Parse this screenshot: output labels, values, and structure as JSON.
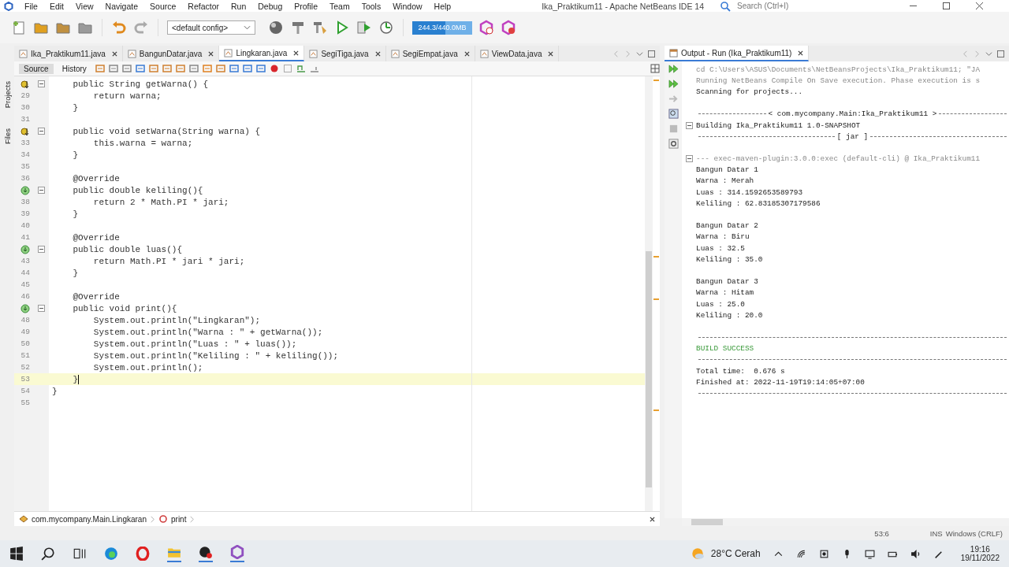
{
  "window": {
    "title": "Ika_Praktikum11 - Apache NetBeans IDE 14"
  },
  "menu": [
    "File",
    "Edit",
    "View",
    "Navigate",
    "Source",
    "Refactor",
    "Run",
    "Debug",
    "Profile",
    "Team",
    "Tools",
    "Window",
    "Help"
  ],
  "search": {
    "placeholder": "Search (Ctrl+I)"
  },
  "toolbar": {
    "config": "<default config>",
    "memory": {
      "reading": "244.3/440.0MB",
      "level": 0.55
    }
  },
  "side_tabs": [
    "Projects",
    "Files"
  ],
  "editor_tabs": [
    {
      "label": "Ika_Praktikum11.java",
      "selected": false
    },
    {
      "label": "BangunDatar.java",
      "selected": false
    },
    {
      "label": "Lingkaran.java",
      "selected": true
    },
    {
      "label": "SegiTiga.java",
      "selected": false
    },
    {
      "label": "SegiEmpat.java",
      "selected": false
    },
    {
      "label": "ViewData.java",
      "selected": false
    }
  ],
  "editor_views": [
    {
      "label": "Source",
      "selected": true
    },
    {
      "label": "History",
      "selected": false
    }
  ],
  "code_lines": [
    {
      "kind": "implements",
      "text": "    public String getWarna() {",
      "fold": true,
      "current": false
    },
    {
      "kind": "plain",
      "number": "29",
      "text": "        return warna;",
      "fold": false,
      "current": false
    },
    {
      "kind": "plain",
      "number": "30",
      "text": "    }",
      "fold": false,
      "current": false
    },
    {
      "kind": "plain",
      "number": "31",
      "fold": false,
      "current": false
    },
    {
      "kind": "implements",
      "text": "    public void setWarna(String warna) {",
      "fold": true,
      "current": false
    },
    {
      "kind": "plain",
      "number": "33",
      "text": "        this.warna = warna;",
      "fold": false,
      "current": false
    },
    {
      "kind": "plain",
      "number": "34",
      "text": "    }",
      "fold": false,
      "current": false
    },
    {
      "kind": "plain",
      "number": "35",
      "fold": false,
      "current": false
    },
    {
      "kind": "plain",
      "number": "36",
      "text": "    @Override",
      "fold": false,
      "current": false
    },
    {
      "kind": "overrides",
      "text": "    public double keliling(){",
      "fold": true,
      "current": false
    },
    {
      "kind": "plain",
      "number": "38",
      "text": "        return 2 * Math.PI * jari;",
      "fold": false,
      "current": false
    },
    {
      "kind": "plain",
      "number": "39",
      "text": "    }",
      "fold": false,
      "current": false
    },
    {
      "kind": "plain",
      "number": "40",
      "fold": false,
      "current": false
    },
    {
      "kind": "plain",
      "number": "41",
      "text": "    @Override",
      "fold": false,
      "current": false
    },
    {
      "kind": "overrides",
      "text": "    public double luas(){",
      "fold": true,
      "current": false
    },
    {
      "kind": "plain",
      "number": "43",
      "text": "        return Math.PI * jari * jari;",
      "fold": false,
      "current": false
    },
    {
      "kind": "plain",
      "number": "44",
      "text": "    }",
      "fold": false,
      "current": false
    },
    {
      "kind": "plain",
      "number": "45",
      "fold": false,
      "current": false
    },
    {
      "kind": "plain",
      "number": "46",
      "text": "    @Override",
      "fold": false,
      "current": false
    },
    {
      "kind": "overrides",
      "text": "    public void print(){",
      "fold": true,
      "current": false
    },
    {
      "kind": "plain",
      "number": "48",
      "text": "        System.out.println(\"Lingkaran\");",
      "fold": false,
      "current": false
    },
    {
      "kind": "plain",
      "number": "49",
      "text": "        System.out.println(\"Warna : \" + getWarna());",
      "fold": false,
      "current": false
    },
    {
      "kind": "plain",
      "number": "50",
      "text": "        System.out.println(\"Luas : \" + luas());",
      "fold": false,
      "current": false
    },
    {
      "kind": "plain",
      "number": "51",
      "text": "        System.out.println(\"Keliling : \" + keliling());",
      "fold": false,
      "current": false
    },
    {
      "kind": "plain",
      "number": "52",
      "text": "        System.out.println();",
      "fold": false,
      "current": false
    },
    {
      "kind": "plain",
      "number": "53",
      "text": "    }",
      "fold": false,
      "current": true
    },
    {
      "kind": "plain",
      "number": "54",
      "text": "}",
      "fold": false,
      "current": false
    },
    {
      "kind": "plain",
      "number": "55",
      "fold": false,
      "current": false
    }
  ],
  "breadcrumb": [
    "com.mycompany.Main.Lingkaran",
    "print"
  ],
  "output": {
    "tab": {
      "label": "Output - Run (Ika_Praktikum11)",
      "selected": true
    },
    "lines": [
      {
        "kind": "command",
        "text": "cd C:\\Users\\ASUS\\Documents\\NetBeansProjects\\Ika_Praktikum11; \"JA",
        "fold": false
      },
      {
        "kind": "command",
        "text": "Running NetBeans Compile On Save execution. Phase execution is s",
        "fold": false
      },
      {
        "kind": "normal",
        "text": "Scanning for projects...",
        "fold": false
      },
      {
        "kind": "blank",
        "fold": false
      },
      {
        "kind": "heading",
        "text": "< com.mycompany.Main:Ika_Praktikum11 >",
        "fold": false
      },
      {
        "kind": "normal",
        "text": "Building Ika_Praktikum11 1.0-SNAPSHOT",
        "fold": true
      },
      {
        "kind": "heading",
        "text": "[ jar ]",
        "fold": false
      },
      {
        "kind": "blank",
        "fold": false
      },
      {
        "kind": "command",
        "text": "--- exec-maven-plugin:3.0.0:exec (default-cli) @ Ika_Praktikum11",
        "fold": true
      },
      {
        "kind": "normal",
        "text": "Bangun Datar 1",
        "fold": false
      },
      {
        "kind": "normal",
        "text": "Warna : Merah",
        "fold": false
      },
      {
        "kind": "normal",
        "text": "Luas : 314.1592653589793",
        "fold": false
      },
      {
        "kind": "normal",
        "text": "Keliling : 62.83185307179586",
        "fold": false
      },
      {
        "kind": "blank",
        "fold": false
      },
      {
        "kind": "normal",
        "text": "Bangun Datar 2",
        "fold": false
      },
      {
        "kind": "normal",
        "text": "Warna : Biru",
        "fold": false
      },
      {
        "kind": "normal",
        "text": "Luas : 32.5",
        "fold": false
      },
      {
        "kind": "normal",
        "text": "Keliling : 35.0",
        "fold": false
      },
      {
        "kind": "blank",
        "fold": false
      },
      {
        "kind": "normal",
        "text": "Bangun Datar 3",
        "fold": false
      },
      {
        "kind": "normal",
        "text": "Warna : Hitam",
        "fold": false
      },
      {
        "kind": "normal",
        "text": "Luas : 25.0",
        "fold": false
      },
      {
        "kind": "normal",
        "text": "Keliling : 20.0",
        "fold": false
      },
      {
        "kind": "blank",
        "fold": false
      },
      {
        "kind": "rule",
        "fold": false
      },
      {
        "kind": "success",
        "text": "BUILD SUCCESS",
        "fold": false
      },
      {
        "kind": "rule",
        "fold": false
      },
      {
        "kind": "normal",
        "text": "Total time:  0.676 s",
        "fold": false
      },
      {
        "kind": "normal",
        "text": "Finished at: 2022-11-19T19:14:05+07:00",
        "fold": false
      },
      {
        "kind": "rule",
        "fold": false
      }
    ]
  },
  "status_bar": {
    "position": "53:6",
    "mode": "INS",
    "line_endings": "Windows (CRLF)"
  },
  "taskbar": {
    "weather": "28°C Cerah",
    "time": "19:16",
    "date": "19/11/2022"
  }
}
